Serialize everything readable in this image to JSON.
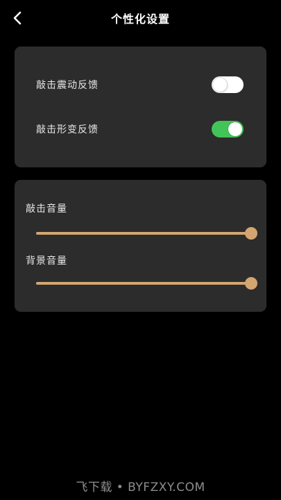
{
  "header": {
    "title": "个性化设置",
    "back_icon": "chevron-left-icon"
  },
  "feedback": {
    "items": [
      {
        "label": "敲击震动反馈",
        "state": "off"
      },
      {
        "label": "敲击形变反馈",
        "state": "on"
      }
    ]
  },
  "volume": {
    "items": [
      {
        "label": "敲击音量",
        "value": 100
      },
      {
        "label": "背景音量",
        "value": 100
      }
    ]
  },
  "watermark": "飞下载 • BYFZXY.COM",
  "colors": {
    "background": "#000000",
    "card": "#2c2c2c",
    "toggle_on": "#43c459",
    "slider_accent": "#d3a571"
  }
}
